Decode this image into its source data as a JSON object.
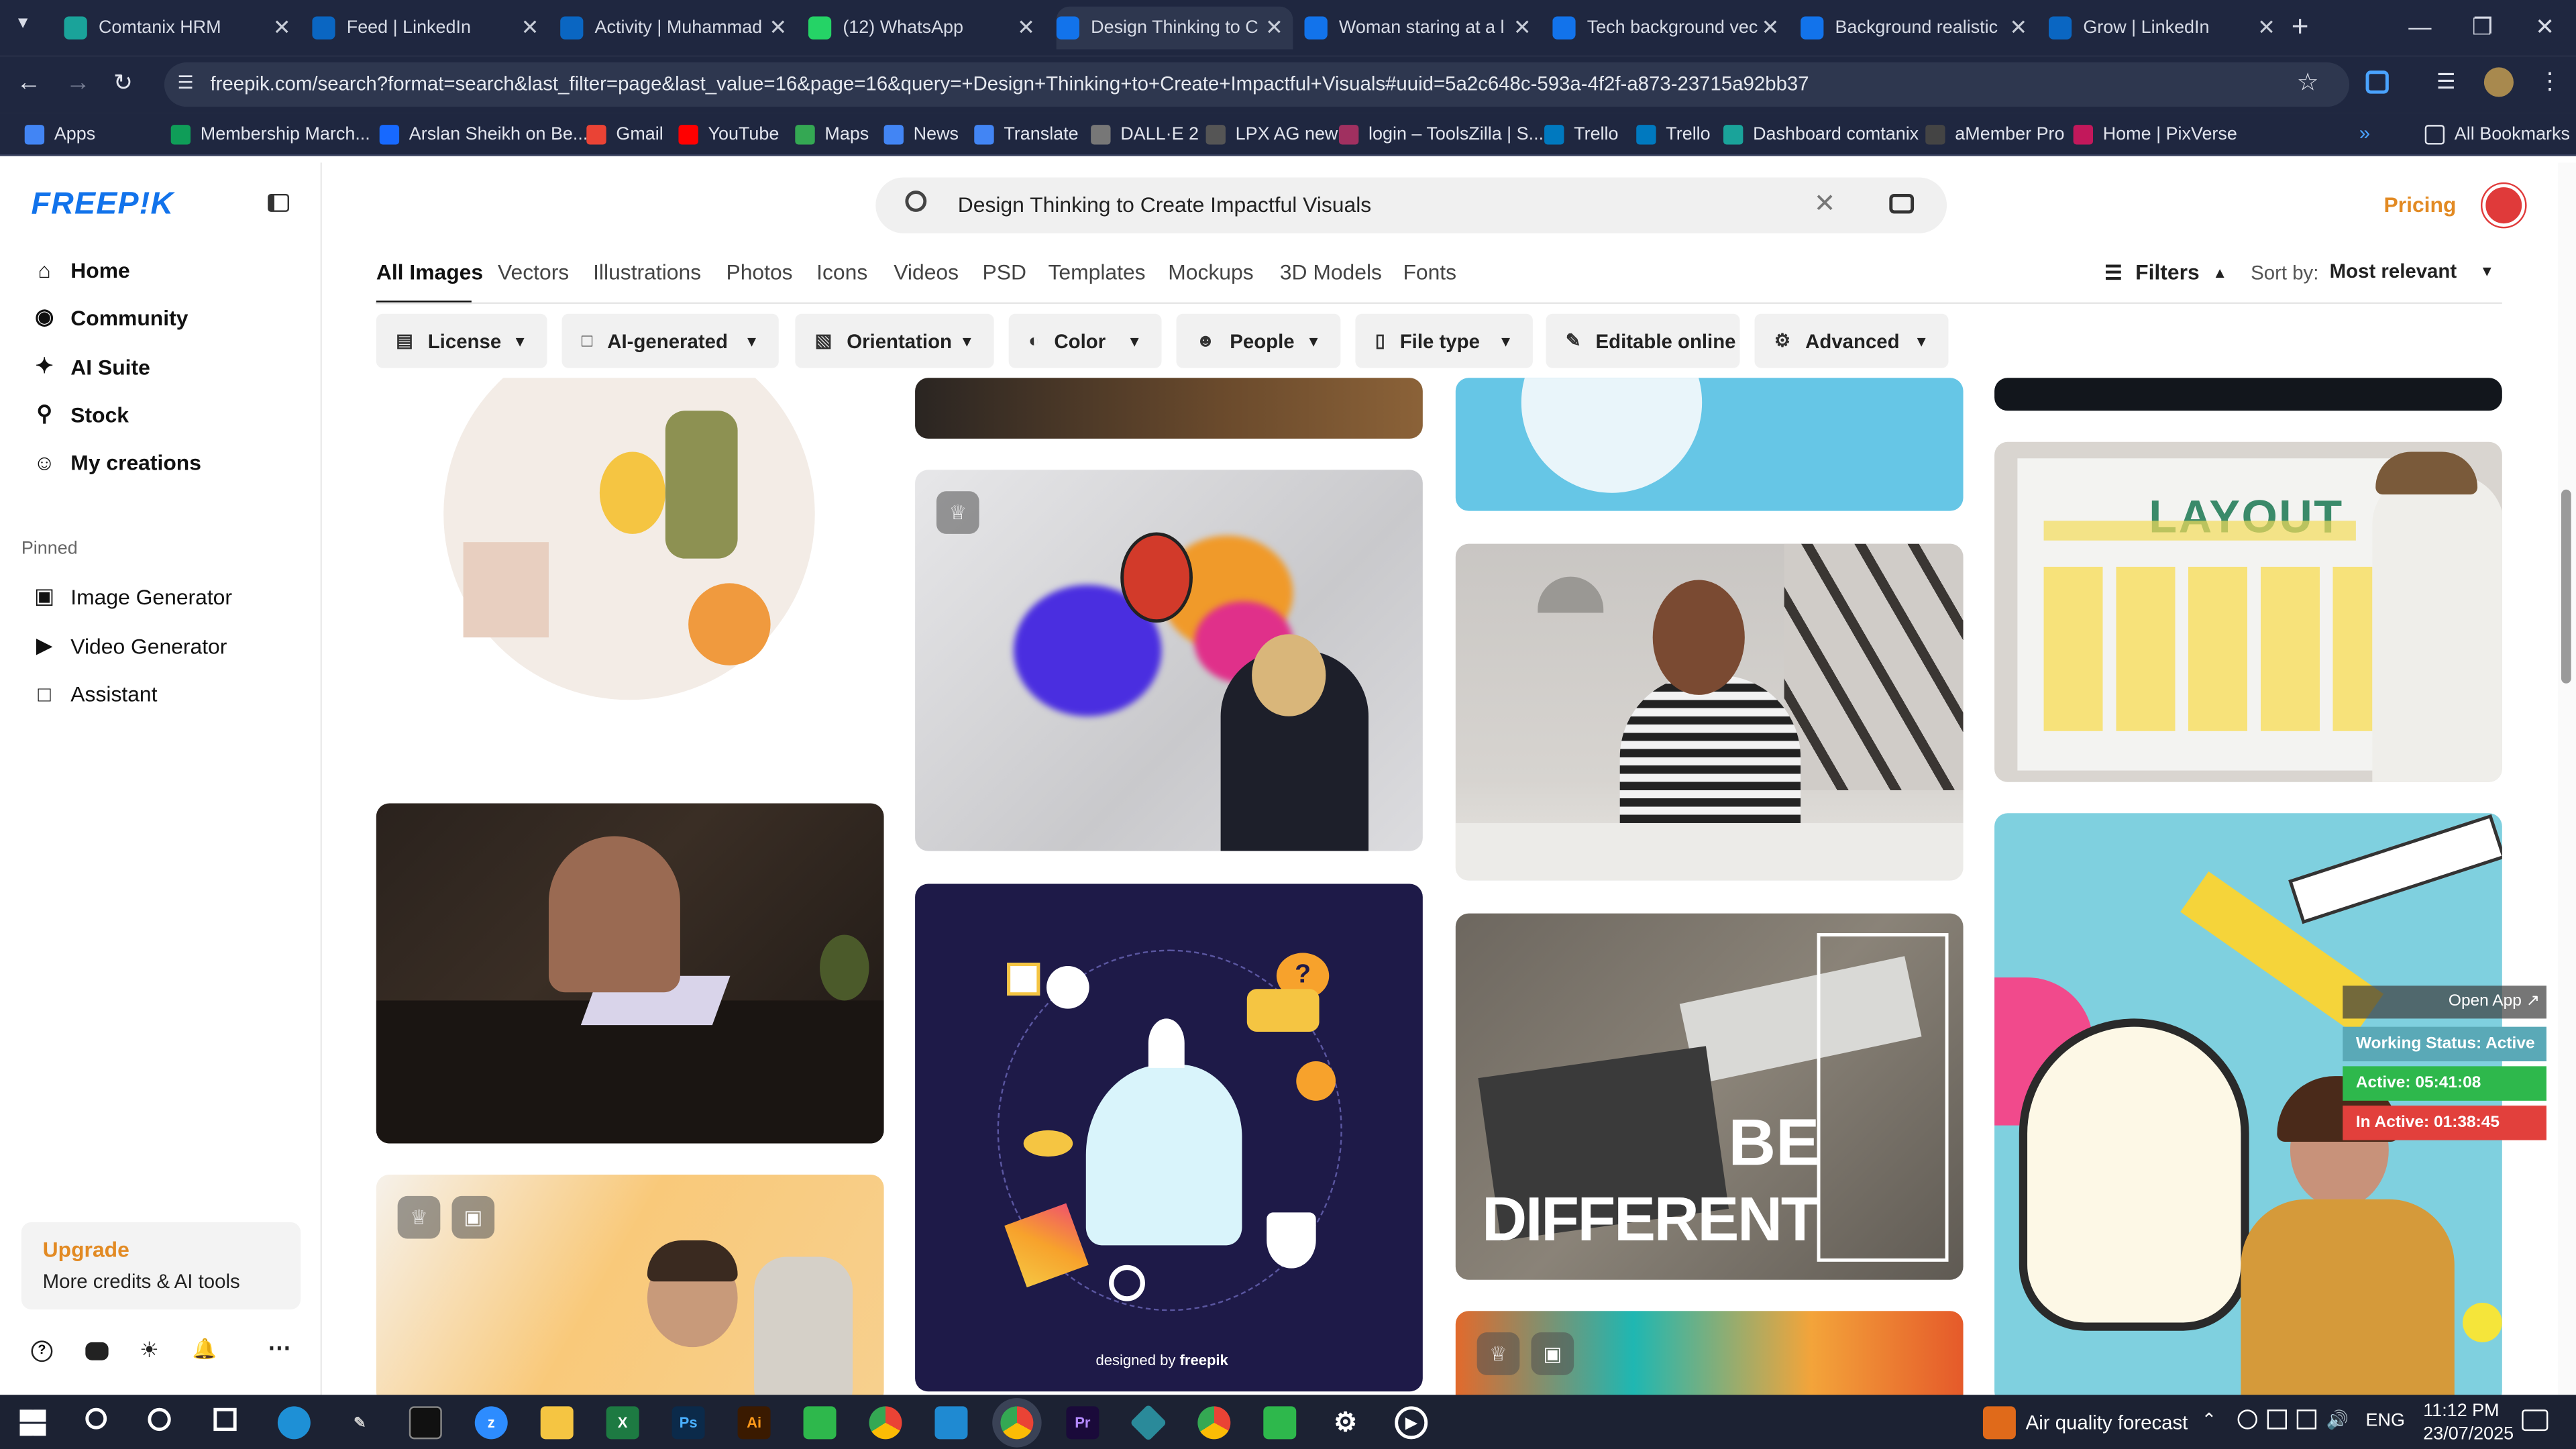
{
  "browser": {
    "tabs": [
      {
        "title": "Comtanix HRM",
        "icon": "comtanix-icon",
        "color": "#1aa39a"
      },
      {
        "title": "Feed | LinkedIn",
        "icon": "linkedin-icon",
        "color": "#0a66c2"
      },
      {
        "title": "Activity | Muhammad",
        "icon": "linkedin-icon",
        "color": "#0a66c2"
      },
      {
        "title": "(12) WhatsApp",
        "icon": "whatsapp-icon",
        "color": "#25d366"
      },
      {
        "title": "Design Thinking to C",
        "icon": "freepik-icon",
        "color": "#1273eb"
      },
      {
        "title": "Woman staring at a l",
        "icon": "freepik-icon",
        "color": "#1273eb"
      },
      {
        "title": "Tech background vec",
        "icon": "freepik-icon",
        "color": "#1273eb"
      },
      {
        "title": "Background realistic",
        "icon": "freepik-icon",
        "color": "#1273eb"
      },
      {
        "title": "Grow | LinkedIn",
        "icon": "linkedin-icon",
        "color": "#0a66c2"
      }
    ],
    "url": "freepik.com/search?format=search&last_filter=page&last_value=16&page=16&query=+Design+Thinking+to+Create+Impactful+Visuals#uuid=5a2c648c-593a-4f2f-a873-23715a92bb37",
    "bookmarks": [
      {
        "label": "Apps",
        "color": "#4285f4"
      },
      {
        "label": "Membership March...",
        "color": "#0f9d58"
      },
      {
        "label": "Arslan Sheikh on Be...",
        "color": "#1769ff"
      },
      {
        "label": "Gmail",
        "color": "#ea4335"
      },
      {
        "label": "YouTube",
        "color": "#ff0000"
      },
      {
        "label": "Maps",
        "color": "#34a853"
      },
      {
        "label": "News",
        "color": "#4285f4"
      },
      {
        "label": "Translate",
        "color": "#4285f4"
      },
      {
        "label": "DALL·E 2",
        "color": "#777777"
      },
      {
        "label": "LPX AG new",
        "color": "#555555"
      },
      {
        "label": "login – ToolsZilla | S...",
        "color": "#a03060"
      },
      {
        "label": "Trello",
        "color": "#0079bf"
      },
      {
        "label": "Trello",
        "color": "#0079bf"
      },
      {
        "label": "Dashboard comtanix",
        "color": "#1aa39a"
      },
      {
        "label": "aMember Pro",
        "color": "#444444"
      },
      {
        "label": "Home | PixVerse",
        "color": "#c2185b"
      }
    ],
    "all_bookmarks": "All Bookmarks"
  },
  "sidebar": {
    "logo": "FREEP!K",
    "nav": [
      {
        "label": "Home",
        "icon": "home-icon"
      },
      {
        "label": "Community",
        "icon": "globe-icon"
      },
      {
        "label": "AI Suite",
        "icon": "sparkle-icon"
      },
      {
        "label": "Stock",
        "icon": "search-icon"
      },
      {
        "label": "My creations",
        "icon": "user-icon"
      }
    ],
    "pinned_label": "Pinned",
    "pinned": [
      {
        "label": "Image Generator",
        "icon": "image-icon"
      },
      {
        "label": "Video Generator",
        "icon": "video-icon"
      },
      {
        "label": "Assistant",
        "icon": "chat-icon"
      }
    ],
    "upgrade_title": "Upgrade",
    "upgrade_sub": "More credits & AI tools"
  },
  "header": {
    "search_value": "Design Thinking to Create Impactful Visuals",
    "pricing": "Pricing"
  },
  "categories": [
    "All Images",
    "Vectors",
    "Illustrations",
    "Photos",
    "Icons",
    "Videos",
    "PSD",
    "Templates",
    "Mockups",
    "3D Models",
    "Fonts"
  ],
  "filters_label": "Filters",
  "sort_label": "Sort by:",
  "sort_value": "Most relevant",
  "filter_buttons": [
    {
      "label": "License",
      "icon": "license-icon"
    },
    {
      "label": "AI-generated",
      "icon": "ai-icon"
    },
    {
      "label": "Orientation",
      "icon": "orientation-icon"
    },
    {
      "label": "Color",
      "icon": "palette-icon"
    },
    {
      "label": "People",
      "icon": "people-icon"
    },
    {
      "label": "File type",
      "icon": "file-icon"
    },
    {
      "label": "Editable online",
      "icon": "edit-icon"
    },
    {
      "label": "Advanced",
      "icon": "gear-icon"
    }
  ],
  "images": {
    "layout_text": "LAYOUT",
    "be_text": "BE",
    "different_text": "DIFFERENT",
    "designed_by": "designed by",
    "freepik_brand": "freepik"
  },
  "widget": {
    "open_app": "Open App ↗",
    "status": "Working Status: Active",
    "active": "Active: 05:41:08",
    "inactive": "In Active: 01:38:45"
  },
  "taskbar": {
    "weather": "Air quality forecast",
    "lang": "ENG",
    "time": "11:12 PM",
    "date": "23/07/2025"
  }
}
